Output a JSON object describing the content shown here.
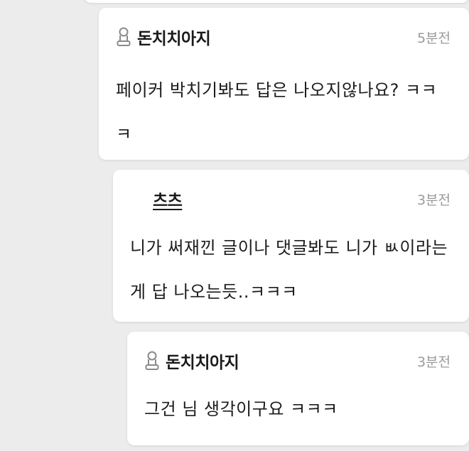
{
  "comments": [
    {
      "author": "돈치치아지",
      "author_icon": "user-badge-icon",
      "time": "5분전",
      "text": "페이커 박치기봐도 답은 나오지않나요? ㅋㅋㅋ"
    },
    {
      "author": "츠츠",
      "time": "3분전",
      "text": "니가 써재낀 글이나 댓글봐도 니가 ㅄ이라는게 답 나오는듯..ㅋㅋㅋ"
    },
    {
      "author": "돈치치아지",
      "author_icon": "user-badge-icon",
      "time": "3분전",
      "text": "그건 님 생각이구요 ㅋㅋㅋ"
    }
  ],
  "colors": {
    "background": "#ececed",
    "card": "#ffffff",
    "time": "#9a9a9a"
  }
}
